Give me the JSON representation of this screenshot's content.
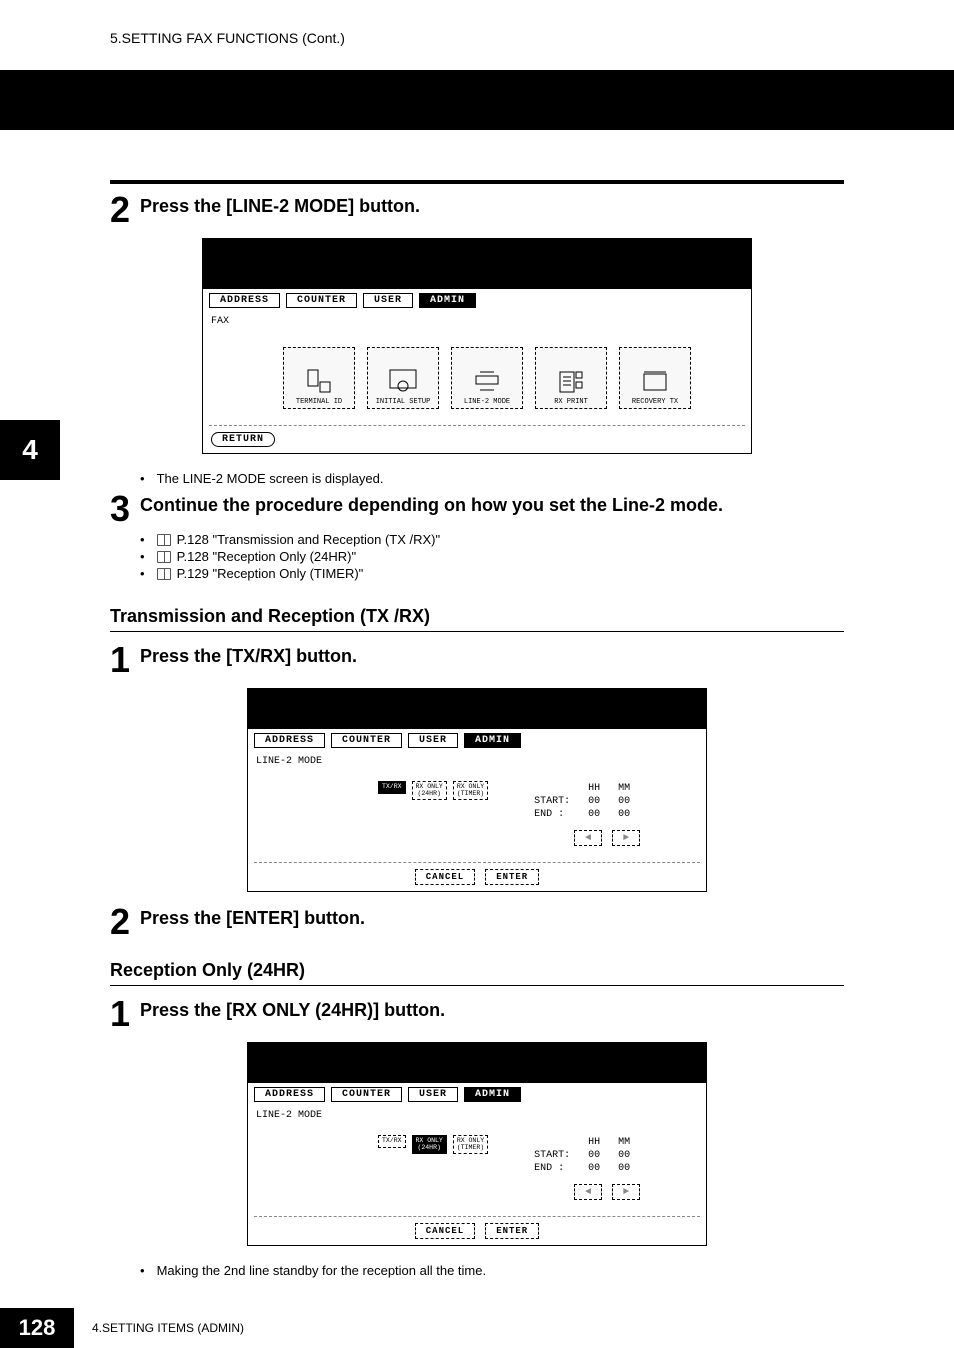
{
  "header": {
    "breadcrumb": "5.SETTING FAX FUNCTIONS (Cont.)"
  },
  "chapter_tab": "4",
  "step2": {
    "num": "2",
    "title": "Press the [LINE-2 MODE] button.",
    "note": "The LINE-2 MODE screen is displayed."
  },
  "lcd1": {
    "tabs": [
      "ADDRESS",
      "COUNTER",
      "USER",
      "ADMIN"
    ],
    "selected_tab_index": 3,
    "subtitle": "FAX",
    "icon_buttons": [
      "TERMINAL ID",
      "INITIAL SETUP",
      "LINE-2 MODE",
      "RX PRINT",
      "RECOVERY TX"
    ],
    "return_label": "RETURN"
  },
  "step3": {
    "num": "3",
    "title": "Continue the procedure depending on how you set the Line-2 mode.",
    "refs": [
      "P.128 \"Transmission and Reception (TX /RX)\"",
      "P.128 \"Reception Only (24HR)\"",
      "P.129 \"Reception Only (TIMER)\""
    ]
  },
  "section_tx": {
    "heading": "Transmission and Reception (TX /RX)",
    "step1": {
      "num": "1",
      "title": "Press the [TX/RX] button."
    },
    "lcd": {
      "tabs": [
        "ADDRESS",
        "COUNTER",
        "USER",
        "ADMIN"
      ],
      "selected_tab_index": 3,
      "subtitle": "LINE-2 MODE",
      "mode_buttons": [
        "TX/RX",
        "RX ONLY\n(24HR)",
        "RX ONLY\n(TIMER)"
      ],
      "selected_mode_index": 0,
      "time": {
        "h_label": "HH",
        "m_label": "MM",
        "start_label": "START:",
        "start_h": "00",
        "start_m": "00",
        "end_label": "END  :",
        "end_h": "00",
        "end_m": "00"
      },
      "cancel": "CANCEL",
      "enter": "ENTER"
    },
    "step2": {
      "num": "2",
      "title": "Press the [ENTER] button."
    }
  },
  "section_rx": {
    "heading": "Reception Only (24HR)",
    "step1": {
      "num": "1",
      "title": "Press the [RX ONLY (24HR)] button."
    },
    "lcd": {
      "tabs": [
        "ADDRESS",
        "COUNTER",
        "USER",
        "ADMIN"
      ],
      "selected_tab_index": 3,
      "subtitle": "LINE-2 MODE",
      "mode_buttons": [
        "TX/RX",
        "RX ONLY\n(24HR)",
        "RX ONLY\n(TIMER)"
      ],
      "selected_mode_index": 1,
      "time": {
        "h_label": "HH",
        "m_label": "MM",
        "start_label": "START:",
        "start_h": "00",
        "start_m": "00",
        "end_label": "END  :",
        "end_h": "00",
        "end_m": "00"
      },
      "cancel": "CANCEL",
      "enter": "ENTER"
    },
    "note": "Making the 2nd line standby for the reception all the time."
  },
  "footer": {
    "page_number": "128",
    "text": "4.SETTING ITEMS (ADMIN)"
  }
}
